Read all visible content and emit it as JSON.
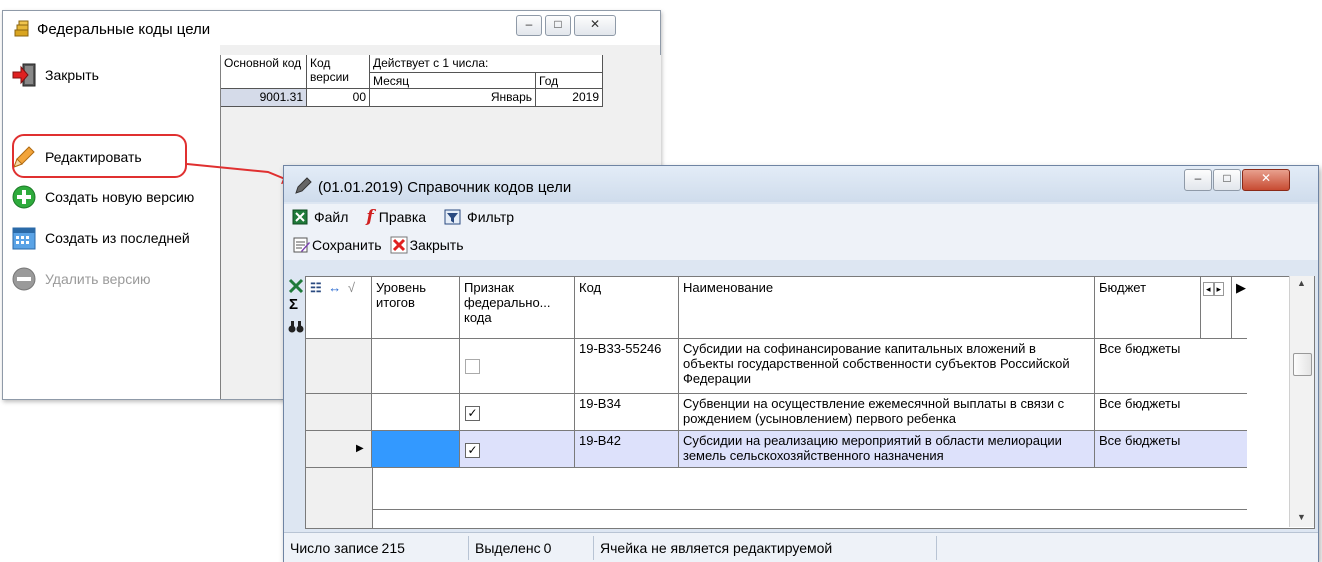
{
  "window1": {
    "title": "Федеральные коды цели",
    "controls": {
      "minimize": "–",
      "maximize": "□",
      "close": "✕"
    },
    "left_buttons": [
      {
        "label": "Закрыть",
        "icon": "exit-door-icon"
      },
      {
        "label": "Редактировать",
        "icon": "pencil-icon"
      },
      {
        "label": "Создать новую версию",
        "icon": "plus-circle-icon"
      },
      {
        "label": "Создать из последней",
        "icon": "calendar-icon"
      },
      {
        "label": "Удалить версию",
        "icon": "minus-circle-icon",
        "disabled": true
      }
    ],
    "grid": {
      "headers": {
        "main_code": "Основной код",
        "version_code": "Код версии",
        "effective_from": "Действует с 1 числа:",
        "month": "Месяц",
        "year": "Год"
      },
      "row": {
        "main_code": "9001.31",
        "version_code": "00",
        "month": "Январь",
        "year": "2019"
      }
    }
  },
  "window2": {
    "title": "(01.01.2019) Справочник кодов цели",
    "menu": [
      {
        "label": "Файл",
        "icon": "excel-icon"
      },
      {
        "label": "Правка",
        "icon": "formula-icon"
      },
      {
        "label": "Фильтр",
        "icon": "filter-icon"
      }
    ],
    "toolbar": [
      {
        "label": "Сохранить",
        "icon": "save-icon"
      },
      {
        "label": "Закрыть",
        "icon": "close-red-icon"
      }
    ],
    "columns": {
      "level": "Уровень итогов",
      "federal": "Признак федерально... кода",
      "code": "Код",
      "name": "Наименование",
      "budget": "Бюджет"
    },
    "rows": [
      {
        "code": "19-В33-55246",
        "name": "Субсидии на софинансирование капитальных вложений в объекты государственной собственности субъектов Российской Федерации",
        "budget": "Все бюджеты",
        "federal": false
      },
      {
        "code": "19-В34",
        "name": "Субвенции на осуществление ежемесячной выплаты в связи с рождением (усыновлением) первого ребенка",
        "budget": "Все бюджеты",
        "federal": true
      },
      {
        "code": "19-В42",
        "name": "Субсидии на реализацию мероприятий в области мелиорации земель сельскохозяйственного назначения",
        "budget": "Все бюджеты",
        "federal": true,
        "selected": true
      }
    ],
    "status": {
      "records_label": "Число записе",
      "records_value": "215",
      "selected_label": "Выделенс",
      "selected_value": "0",
      "message": "Ячейка не является редактируемой"
    },
    "colors": {
      "selection": "#dde1fb",
      "active_cell": "#3399ff",
      "callout": "#e03030"
    }
  }
}
